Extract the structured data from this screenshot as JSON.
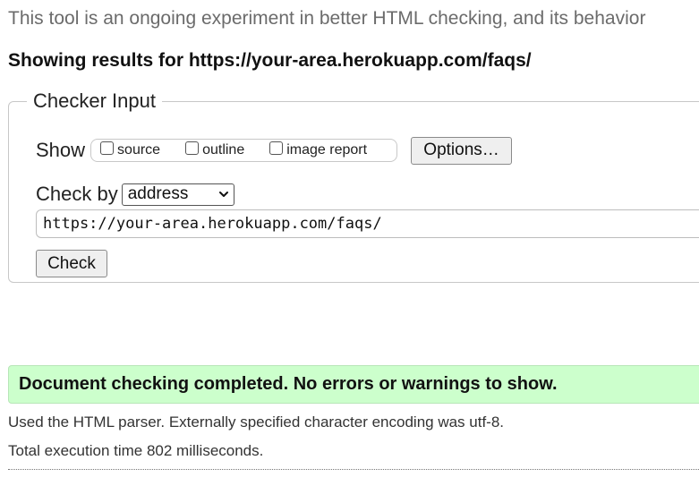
{
  "intro_text": "This tool is an ongoing experiment in better HTML checking, and its behavior",
  "results_heading": "Showing results for https://your-area.herokuapp.com/faqs/",
  "checker": {
    "legend": "Checker Input",
    "show_label": "Show",
    "show_options": [
      {
        "label": "source",
        "checked": false
      },
      {
        "label": "outline",
        "checked": false
      },
      {
        "label": "image report",
        "checked": false
      }
    ],
    "options_button": "Options…",
    "check_by_label": "Check by",
    "check_by_selected": "address",
    "url_value": "https://your-area.herokuapp.com/faqs/",
    "check_button": "Check"
  },
  "result": {
    "status_message": "Document checking completed. No errors or warnings to show.",
    "status_color": "#ccffcc",
    "parser_info": "Used the HTML parser. Externally specified character encoding was utf-8.",
    "execution_time": "Total execution time 802 milliseconds."
  }
}
